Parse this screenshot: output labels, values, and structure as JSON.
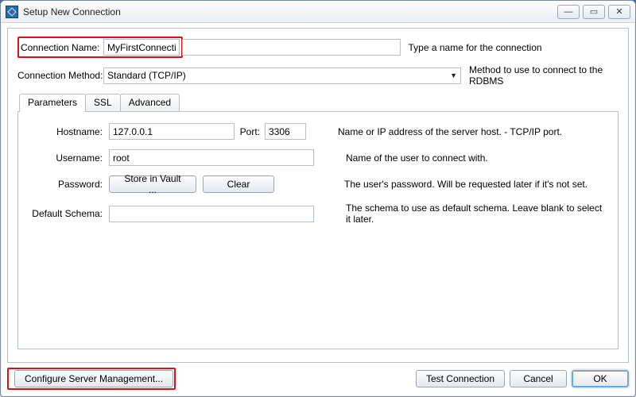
{
  "window": {
    "title": "Setup New Connection",
    "min_glyph": "—",
    "max_glyph": "▭",
    "close_glyph": "✕"
  },
  "conn_name": {
    "label": "Connection Name:",
    "value": "MyFirstConnection",
    "hint": "Type a name for the connection"
  },
  "conn_method": {
    "label": "Connection Method:",
    "value": "Standard (TCP/IP)",
    "hint": "Method to use to connect to the RDBMS"
  },
  "tabs": {
    "parameters": "Parameters",
    "ssl": "SSL",
    "advanced": "Advanced"
  },
  "params": {
    "hostname_label": "Hostname:",
    "hostname_value": "127.0.0.1",
    "port_label": "Port:",
    "port_value": "3306",
    "host_hint": "Name or IP address of the server host. - TCP/IP port.",
    "username_label": "Username:",
    "username_value": "root",
    "username_hint": "Name of the user to connect with.",
    "password_label": "Password:",
    "store_vault": "Store in Vault ...",
    "clear": "Clear",
    "password_hint": "The user's password. Will be requested later if it's not set.",
    "schema_label": "Default Schema:",
    "schema_value": "",
    "schema_hint": "The schema to use as default schema. Leave blank to select it later."
  },
  "footer": {
    "configure": "Configure Server Management...",
    "test": "Test Connection",
    "cancel": "Cancel",
    "ok": "OK"
  }
}
